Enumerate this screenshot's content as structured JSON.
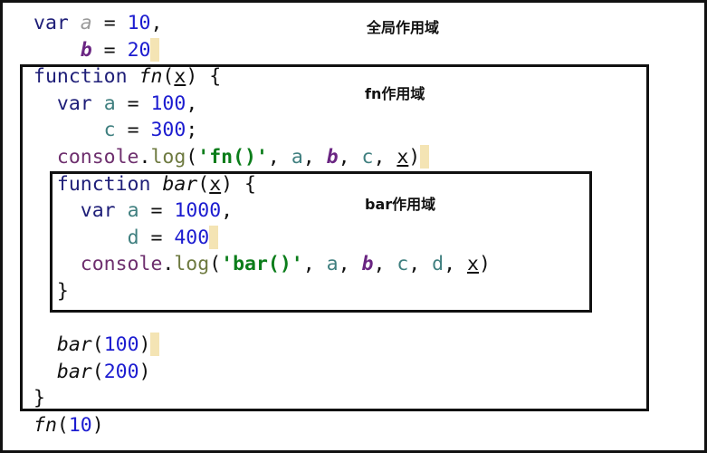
{
  "scope_labels": {
    "global": "全局作用域",
    "fn": "fn作用域",
    "bar": "bar作用域"
  },
  "code_lines": [
    {
      "indent": 0,
      "hl": false,
      "tokens": [
        [
          "var",
          "kw"
        ],
        [
          " ",
          "p"
        ],
        [
          "a",
          "gvar"
        ],
        [
          " = ",
          "p"
        ],
        [
          "10",
          "num"
        ],
        [
          ",",
          "p"
        ]
      ]
    },
    {
      "indent": 4,
      "hl": true,
      "tokens": [
        [
          "b",
          "gb"
        ],
        [
          " = ",
          "p"
        ],
        [
          "20",
          "num"
        ]
      ]
    },
    {
      "indent": 0,
      "hl": false,
      "tokens": [
        [
          "function",
          "kw"
        ],
        [
          " ",
          "p"
        ],
        [
          "fn",
          "fnm"
        ],
        [
          "(",
          "p"
        ],
        [
          "x",
          "param"
        ],
        [
          ") {",
          "p"
        ]
      ]
    },
    {
      "indent": 2,
      "hl": false,
      "tokens": [
        [
          "var",
          "kw"
        ],
        [
          " ",
          "p"
        ],
        [
          "a",
          "lv"
        ],
        [
          " = ",
          "p"
        ],
        [
          "100",
          "num"
        ],
        [
          ",",
          "p"
        ]
      ]
    },
    {
      "indent": 6,
      "hl": false,
      "tokens": [
        [
          "c",
          "lv"
        ],
        [
          " = ",
          "p"
        ],
        [
          "300",
          "num"
        ],
        [
          ";",
          "p"
        ]
      ]
    },
    {
      "indent": 2,
      "hl": true,
      "tokens": [
        [
          "console",
          "con"
        ],
        [
          ".",
          "p"
        ],
        [
          "log",
          "log"
        ],
        [
          "(",
          "p"
        ],
        [
          "'fn()'",
          "str"
        ],
        [
          ", ",
          "p"
        ],
        [
          "a",
          "lv"
        ],
        [
          ", ",
          "p"
        ],
        [
          "b",
          "gb"
        ],
        [
          ", ",
          "p"
        ],
        [
          "c",
          "lv"
        ],
        [
          ", ",
          "p"
        ],
        [
          "x",
          "param"
        ],
        [
          ")",
          "p"
        ]
      ]
    },
    {
      "indent": 2,
      "hl": false,
      "tokens": [
        [
          "function",
          "kw"
        ],
        [
          " ",
          "p"
        ],
        [
          "bar",
          "fnm"
        ],
        [
          "(",
          "p"
        ],
        [
          "x",
          "param"
        ],
        [
          ") {",
          "p"
        ]
      ]
    },
    {
      "indent": 4,
      "hl": false,
      "tokens": [
        [
          "var",
          "kw"
        ],
        [
          " ",
          "p"
        ],
        [
          "a",
          "lv"
        ],
        [
          " = ",
          "p"
        ],
        [
          "1000",
          "num"
        ],
        [
          ",",
          "p"
        ]
      ]
    },
    {
      "indent": 8,
      "hl": true,
      "tokens": [
        [
          "d",
          "lv"
        ],
        [
          " = ",
          "p"
        ],
        [
          "400",
          "num"
        ]
      ]
    },
    {
      "indent": 4,
      "hl": false,
      "tokens": [
        [
          "console",
          "con"
        ],
        [
          ".",
          "p"
        ],
        [
          "log",
          "log"
        ],
        [
          "(",
          "p"
        ],
        [
          "'bar()'",
          "str"
        ],
        [
          ", ",
          "p"
        ],
        [
          "a",
          "lv"
        ],
        [
          ", ",
          "p"
        ],
        [
          "b",
          "gb"
        ],
        [
          ", ",
          "p"
        ],
        [
          "c",
          "lv"
        ],
        [
          ", ",
          "p"
        ],
        [
          "d",
          "lv"
        ],
        [
          ", ",
          "p"
        ],
        [
          "x",
          "param"
        ],
        [
          ")",
          "p"
        ]
      ]
    },
    {
      "indent": 2,
      "hl": false,
      "tokens": [
        [
          "}",
          "p"
        ]
      ]
    },
    {
      "indent": 0,
      "hl": false,
      "tokens": []
    },
    {
      "indent": 2,
      "hl": true,
      "tokens": [
        [
          "bar",
          "fnm"
        ],
        [
          "(",
          "p"
        ],
        [
          "100",
          "num"
        ],
        [
          ")",
          "p"
        ]
      ]
    },
    {
      "indent": 2,
      "hl": false,
      "tokens": [
        [
          "bar",
          "fnm"
        ],
        [
          "(",
          "p"
        ],
        [
          "200",
          "num"
        ],
        [
          ")",
          "p"
        ]
      ]
    },
    {
      "indent": 0,
      "hl": false,
      "tokens": [
        [
          "}",
          "p"
        ]
      ]
    },
    {
      "indent": 0,
      "hl": false,
      "tokens": [
        [
          "fn",
          "fnm"
        ],
        [
          "(",
          "p"
        ],
        [
          "10",
          "num"
        ],
        [
          ")",
          "p"
        ]
      ]
    }
  ]
}
